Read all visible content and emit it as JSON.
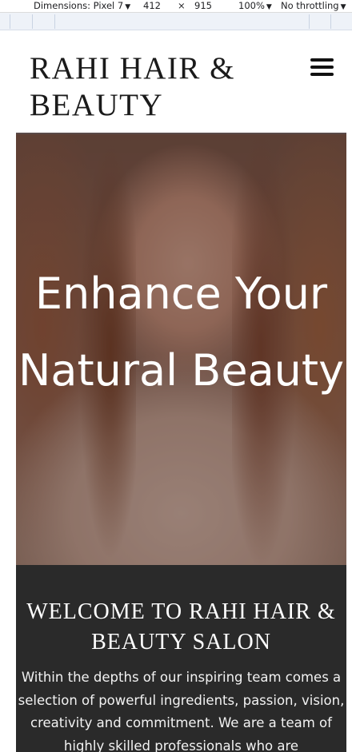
{
  "devtools": {
    "dimensions_label": "Dimensions: Pixel 7",
    "width": "412",
    "times": "×",
    "height": "915",
    "zoom": "100%",
    "throttling": "No throttling",
    "caret": "▼"
  },
  "header": {
    "logo_text": "RAHI HAIR & BEAUTY",
    "menu_icon": "hamburger-menu-icon"
  },
  "hero": {
    "title": "Enhance Your Natural Beauty"
  },
  "welcome": {
    "heading": "WELCOME TO RAHI HAIR & BEAUTY SALON",
    "text": "Within the depths of our inspiring team comes a selection of powerful ingredients, passion, vision, creativity and commitment. We are a team of highly skilled professionals who are"
  }
}
